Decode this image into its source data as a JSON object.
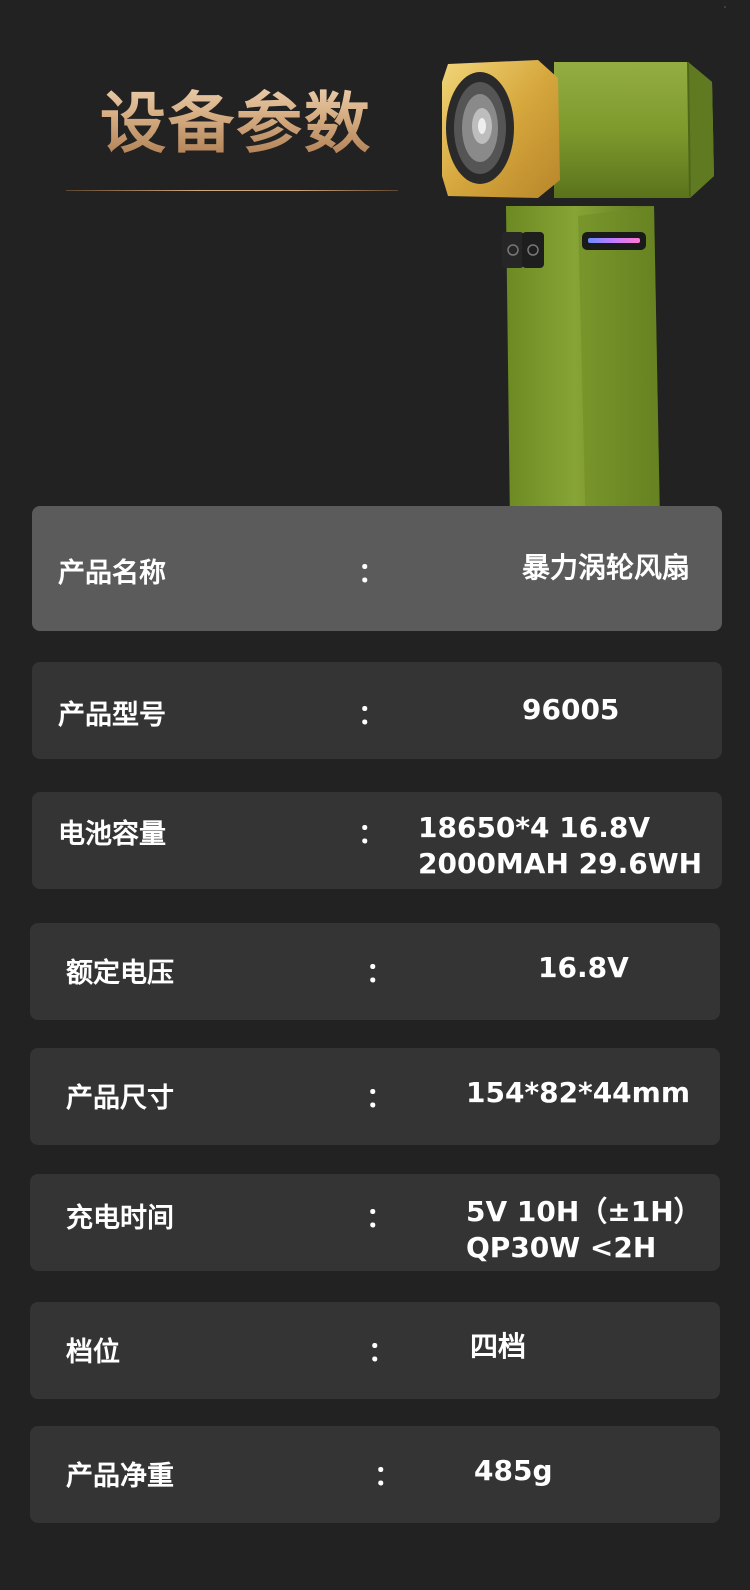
{
  "header": {
    "title": "设备参数"
  },
  "product_image": {
    "icon": "handheld-turbo-fan-illustration",
    "colors": {
      "body": "#7f9b2f",
      "body_dark": "#5f7820",
      "head_gold": "#d9b04a",
      "button_dark": "#262626"
    }
  },
  "specs": {
    "rows": [
      {
        "label": "产品名称",
        "colon": "：",
        "value": "暴力涡轮风扇"
      },
      {
        "label": "产品型号",
        "colon": "：",
        "value": "96005"
      },
      {
        "label": "电池容量",
        "colon": "：",
        "value_lines": [
          "18650*4  16.8V",
          "2000MAH   29.6WH"
        ]
      },
      {
        "label": "额定电压",
        "colon": "：",
        "value": "16.8V"
      },
      {
        "label": "产品尺寸",
        "colon": "：",
        "value": "154*82*44mm"
      },
      {
        "label": "充电时间",
        "colon": "：",
        "value_lines": [
          "5V 10H（±1H）",
          "QP30W <2H"
        ]
      },
      {
        "label": "档位",
        "colon": "：",
        "value": "四档"
      },
      {
        "label": "产品净重",
        "colon": "：",
        "value": "485g"
      }
    ]
  }
}
